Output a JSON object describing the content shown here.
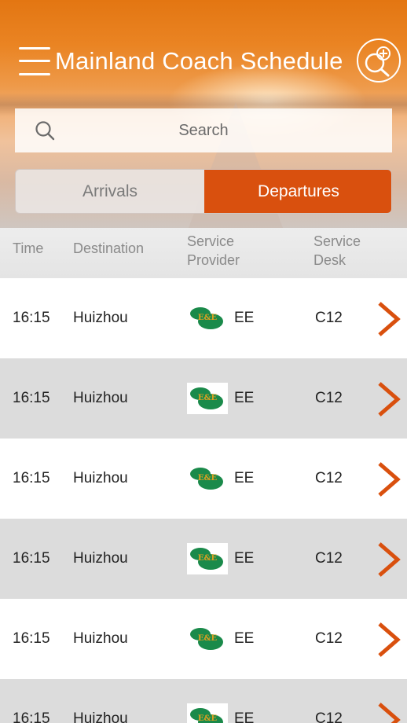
{
  "header": {
    "title": "Mainland Coach Schedule",
    "menu_icon": "hamburger-menu-icon",
    "zoom_icon": "zoom-in-icon"
  },
  "search": {
    "placeholder": "Search",
    "icon": "search-icon"
  },
  "tabs": [
    {
      "label": "Arrivals",
      "selected": false
    },
    {
      "label": "Departures",
      "selected": true
    }
  ],
  "columns": {
    "time": "Time",
    "destination": "Destination",
    "provider_line1": "Service",
    "provider_line2": "Provider",
    "desk_line1": "Service",
    "desk_line2": "Desk"
  },
  "rows": [
    {
      "time": "16:15",
      "destination": "Huizhou",
      "provider_logo": "E&E",
      "provider_code": "EE",
      "desk": "C12"
    },
    {
      "time": "16:15",
      "destination": "Huizhou",
      "provider_logo": "E&E",
      "provider_code": "EE",
      "desk": "C12"
    },
    {
      "time": "16:15",
      "destination": "Huizhou",
      "provider_logo": "E&E",
      "provider_code": "EE",
      "desk": "C12"
    },
    {
      "time": "16:15",
      "destination": "Huizhou",
      "provider_logo": "E&E",
      "provider_code": "EE",
      "desk": "C12"
    },
    {
      "time": "16:15",
      "destination": "Huizhou",
      "provider_logo": "E&E",
      "provider_code": "EE",
      "desk": "C12"
    },
    {
      "time": "16:15",
      "destination": "Huizhou",
      "provider_logo": "E&E",
      "provider_code": "EE",
      "desk": "C12"
    }
  ],
  "colors": {
    "accent": "#d9500e",
    "header_top": "#e37612",
    "row_alt": "#dcdcdc",
    "logo_green": "#1a8a4a",
    "logo_gold": "#e0a020"
  }
}
